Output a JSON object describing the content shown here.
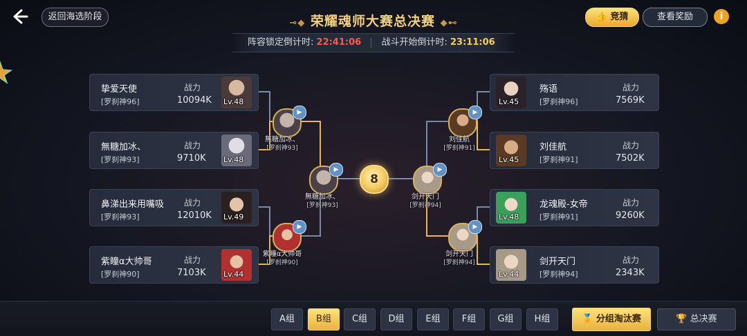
{
  "header": {
    "back_icon": "back-arrow-icon",
    "return_label": "返回海选阶段",
    "title": "荣耀魂师大赛总决赛",
    "lock_label": "阵容锁定倒计时:",
    "lock_time": "22:41:06",
    "battle_label": "战斗开始倒计时:",
    "battle_time": "23:11:06",
    "guess_label": "竞猜",
    "reward_label": "查看奖励",
    "info_label": "i"
  },
  "colors": {
    "gold": "#e9b23c",
    "accent_line_win": "#e8b84a",
    "accent_line_lose": "#7b8aa8",
    "timer_red": "#ff5a4e",
    "timer_yellow": "#f5d04e"
  },
  "power_label": "战力",
  "left_players": [
    {
      "name": "挚爱天使",
      "team": "[罗刹神96]",
      "power": "10094K",
      "level": "Lv.48"
    },
    {
      "name": "無糖加冰、",
      "team": "[罗刹神93]",
      "power": "9710K",
      "level": "Lv.48"
    },
    {
      "name": "鼻涕出来用嘴吸",
      "team": "[罗刹神93]",
      "power": "12010K",
      "level": "Lv.49"
    },
    {
      "name": "紫瞳α大帅哥",
      "team": "[罗刹神90]",
      "power": "7103K",
      "level": "Lv.44"
    }
  ],
  "right_players": [
    {
      "name": "殇语",
      "team": "[罗刹神96]",
      "power": "7569K",
      "level": "Lv.45"
    },
    {
      "name": "刘佳航",
      "team": "[罗刹神91]",
      "power": "7502K",
      "level": "Lv.45"
    },
    {
      "name": "龙魂殿-女帝",
      "team": "[罗刹神91]",
      "power": "9260K",
      "level": "Lv.48"
    },
    {
      "name": "剑开天门",
      "team": "[罗刹神94]",
      "power": "2343K",
      "level": "Lv.44"
    }
  ],
  "winners": {
    "left_r1_top": {
      "name": "無糖加冰、",
      "team": "[罗刹神93]"
    },
    "left_r1_bottom": {
      "name": "紫瞳α大帅哥",
      "team": "[罗刹神90]"
    },
    "left_r2": {
      "name": "無糖加冰、",
      "team": "[罗刹神93]"
    },
    "right_r1_top": {
      "name": "刘佳航",
      "team": "[罗刹神91]"
    },
    "right_r1_bottom": {
      "name": "剑开天门",
      "team": "[罗刹神94]"
    },
    "right_r2": {
      "name": "剑开天门",
      "team": "[罗刹神94]"
    }
  },
  "center_round": "8",
  "groups": [
    "A组",
    "B组",
    "C组",
    "D组",
    "E组",
    "F组",
    "G组",
    "H组"
  ],
  "active_group": "B组",
  "knockout_label": "分组淘汰赛",
  "final_label": "总决赛"
}
